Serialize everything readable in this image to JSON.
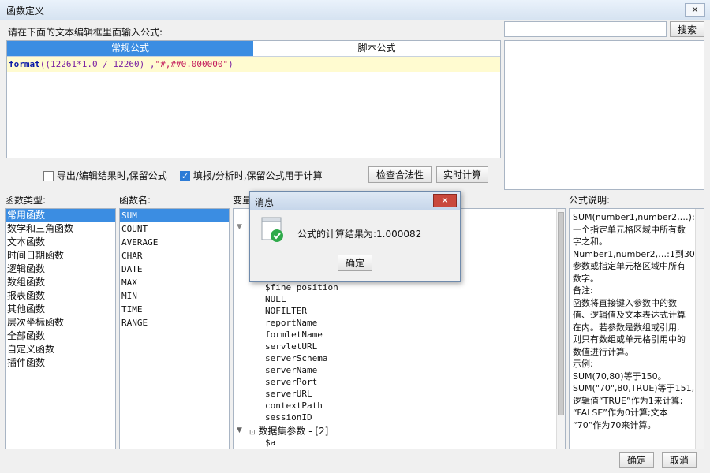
{
  "window": {
    "title": "函数定义",
    "close_glyph": "✕"
  },
  "instruction": "请在下面的文本编辑框里面输入公式:",
  "search": {
    "value": "",
    "button": "搜索"
  },
  "tabs": [
    {
      "label": "常规公式",
      "active": true
    },
    {
      "label": "脚本公式",
      "active": false
    }
  ],
  "formula": {
    "fn": "format",
    "rest": "((12261*1.0 / 12260) ,",
    "str": "\"#,##0.000000\"",
    "close": ")"
  },
  "options": {
    "keep_on_export": {
      "label": "导出/编辑结果时,保留公式",
      "checked": false
    },
    "keep_on_fill": {
      "label": "填报/分析时,保留公式用于计算",
      "checked": true
    },
    "check_button": "检查合法性",
    "realtime_button": "实时计算"
  },
  "function_types": {
    "label": "函数类型:",
    "items": [
      "常用函数",
      "数学和三角函数",
      "文本函数",
      "时间日期函数",
      "逻辑函数",
      "数组函数",
      "报表函数",
      "其他函数",
      "层次坐标函数",
      "全部函数",
      "自定义函数",
      "插件函数"
    ],
    "selected": 0
  },
  "function_names": {
    "label": "函数名:",
    "items": [
      "SUM",
      "COUNT",
      "AVERAGE",
      "CHAR",
      "DATE",
      "MAX",
      "MIN",
      "TIME",
      "RANGE"
    ],
    "selected": 0
  },
  "variables": {
    "label": "变量",
    "items": [
      "$fine_position",
      "NULL",
      "NOFILTER",
      "reportName",
      "formletName",
      "servletURL",
      "serverSchema",
      "serverName",
      "serverPort",
      "serverURL",
      "contextPath",
      "sessionID"
    ],
    "dataset_group": "数据集参数 - [2]",
    "dataset_items": [
      "$a"
    ]
  },
  "description": {
    "label": "公式说明:",
    "lines": [
      "SUM(number1,number2,…):求",
      "一个指定单元格区域中所有数",
      "字之和。",
      "Number1,number2,…:1到30个",
      "参数或指定单元格区域中所有",
      "数字。",
      "备注:",
      "函数将直接键入参数中的数",
      "值、逻辑值及文本表达式计算",
      "在内。若参数是数组或引用,",
      "则只有数组或单元格引用中的",
      "数值进行计算。",
      "示例:",
      "SUM(70,80)等于150。",
      "SUM(\"70\",80,TRUE)等于151,",
      "逻辑值“TRUE”作为1来计算;",
      "“FALSE”作为0计算;文本",
      "“70”作为70来计算。"
    ]
  },
  "dialog": {
    "title": "消息",
    "message": "公式的计算结果为:1.000082",
    "ok": "确定",
    "close_glyph": "✕"
  },
  "footer": {
    "ok": "确定",
    "cancel": "取消"
  },
  "colors": {
    "accent": "#3b8de2",
    "keyword": "#0a1aa8",
    "number": "#7a1fa2",
    "string": "#c2185b",
    "editor_line": "#fffbd0"
  }
}
